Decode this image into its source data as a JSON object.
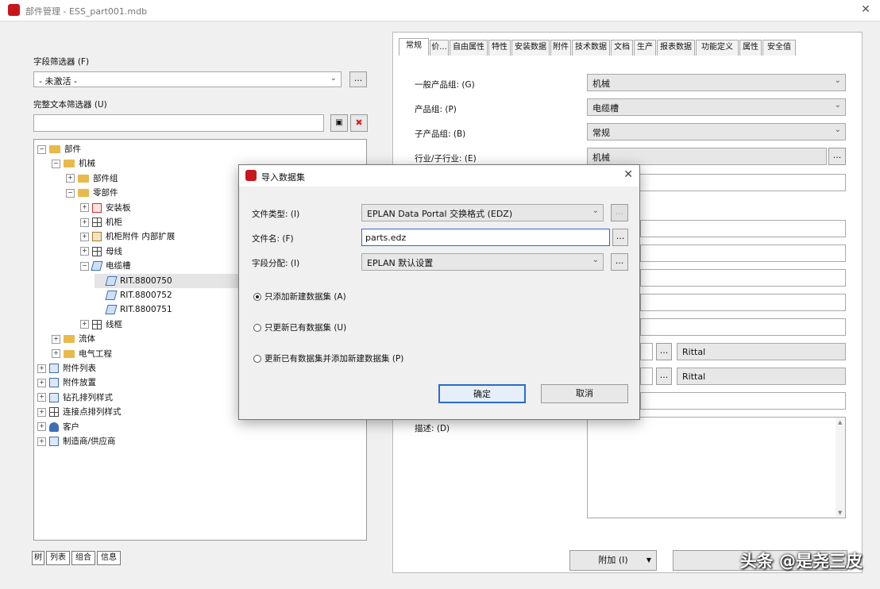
{
  "window": {
    "title": "部件管理 - ESS_part001.mdb",
    "close": "✕"
  },
  "left": {
    "field_filter_label": "字段筛选器 (F)",
    "field_filter_value": "- 未激活 -",
    "text_filter_label": "完整文本筛选器 (U)",
    "text_filter_value": "",
    "tree": [
      {
        "exp": "⊟",
        "icon": "folder",
        "label": "部件",
        "level": 0
      },
      {
        "exp": "⊟",
        "icon": "folder",
        "label": "机械",
        "level": 1
      },
      {
        "exp": "⊞",
        "icon": "folder",
        "label": "部件组",
        "level": 2
      },
      {
        "exp": "⊟",
        "icon": "folder",
        "label": "零部件",
        "level": 2
      },
      {
        "exp": "⊞",
        "icon": "red",
        "label": "安装板",
        "level": 3
      },
      {
        "exp": "⊞",
        "icon": "grid",
        "label": "机柜",
        "level": 3
      },
      {
        "exp": "⊞",
        "icon": "brown",
        "label": "机柜附件 内部扩展",
        "level": 3
      },
      {
        "exp": "⊞",
        "icon": "grid",
        "label": "母线",
        "level": 3
      },
      {
        "exp": "⊟",
        "icon": "part",
        "label": "电缆槽",
        "level": 3
      },
      {
        "exp": "",
        "icon": "part",
        "label": "RIT.8800750",
        "level": 4,
        "selected": true
      },
      {
        "exp": "",
        "icon": "part",
        "label": "RIT.8800752",
        "level": 4
      },
      {
        "exp": "",
        "icon": "part",
        "label": "RIT.8800751",
        "level": 4
      },
      {
        "exp": "⊞",
        "icon": "grid",
        "label": "线框",
        "level": 3
      },
      {
        "exp": "⊞",
        "icon": "folder",
        "label": "流体",
        "level": 1
      },
      {
        "exp": "⊞",
        "icon": "folder",
        "label": "电气工程",
        "level": 1
      },
      {
        "exp": "⊞",
        "icon": "blue",
        "label": "附件列表",
        "level": 0
      },
      {
        "exp": "⊞",
        "icon": "blue",
        "label": "附件放置",
        "level": 0
      },
      {
        "exp": "⊞",
        "icon": "blue",
        "label": "钻孔排列样式",
        "level": 0
      },
      {
        "exp": "⊞",
        "icon": "grid",
        "label": "连接点排列样式",
        "level": 0
      },
      {
        "exp": "⊞",
        "icon": "person",
        "label": "客户",
        "level": 0
      },
      {
        "exp": "⊞",
        "icon": "blue",
        "label": "制造商/供应商",
        "level": 0
      }
    ],
    "bottom_tabs": [
      "树",
      "列表",
      "组合",
      "信息"
    ]
  },
  "right": {
    "tabs": [
      "常规",
      "价...",
      "自由属性",
      "特性",
      "安装数据",
      "附件",
      "技术数据",
      "文档",
      "生产",
      "报表数据",
      "功能定义",
      "属性",
      "安全值"
    ],
    "fields": [
      {
        "label": "一般产品组: (G)",
        "value": "机械",
        "type": "combo"
      },
      {
        "label": "产品组: (P)",
        "value": "电缆槽",
        "type": "combo"
      },
      {
        "label": "子产品组: (B)",
        "value": "常规",
        "type": "combo"
      },
      {
        "label": "行业/子行业: (E)",
        "value": "机械",
        "type": "dots"
      }
    ],
    "rittal_1": "Rittal",
    "rittal_2": "Rittal",
    "description_label": "描述: (D)",
    "append_button": "附加 (I)"
  },
  "dialog": {
    "title": "导入数据集",
    "close": "✕",
    "file_type_label": "文件类型: (I)",
    "file_type_value": "EPLAN Data Portal 交换格式 (EDZ)",
    "file_name_label": "文件名: (F)",
    "file_name_value": "parts.edz",
    "field_assign_label": "字段分配: (I)",
    "field_assign_value": "EPLAN 默认设置",
    "dots": "...",
    "radio_1": "只添加新建数据集 (A)",
    "radio_2": "只更新已有数据集 (U)",
    "radio_3": "更新已有数据集并添加新建数据集 (P)",
    "ok": "确定",
    "cancel": "取消"
  },
  "watermark": "头条 @是尧三皮"
}
